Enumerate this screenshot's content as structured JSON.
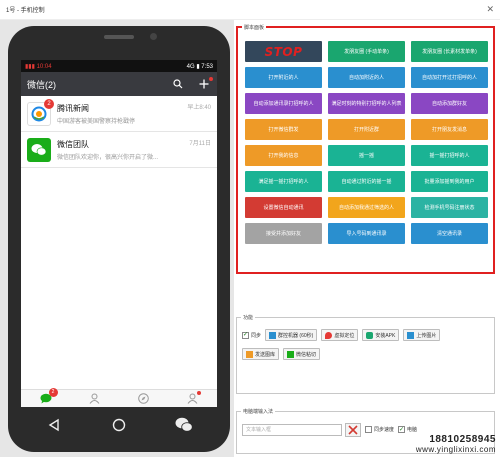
{
  "window": {
    "title": "1号 - 手机控制",
    "close": "✕"
  },
  "phone": {
    "status": {
      "left": "▮▮▮ 10:04",
      "right": "4G ▮ 7:53"
    },
    "header": {
      "title": "微信(2)"
    },
    "chats": [
      {
        "name": "腾讯新闻",
        "preview": "中国游客被美国警察持枪戳停",
        "time": "早上8:40",
        "badge": "2"
      },
      {
        "name": "微信团队",
        "preview": "微信团队欢迎你，很高兴你开启了微...",
        "time": "7月11日"
      }
    ],
    "tabbar": {
      "chats_badge": "2"
    }
  },
  "script_panel": {
    "legend": "脚本面板",
    "buttons": [
      {
        "label": "STOP",
        "color": "#33475b"
      },
      {
        "label": "发朋友圈 (手动单条)",
        "color": "#1aa66f"
      },
      {
        "label": "发朋友圈 (长素材发单条)",
        "color": "#1aa66f"
      },
      {
        "label": "打开附近的人",
        "color": "#2a8fcf"
      },
      {
        "label": "自动加附近的人",
        "color": "#2a8fcf"
      },
      {
        "label": "自动加打开过打招呼的人",
        "color": "#2a8fcf"
      },
      {
        "label": "自动添加通讯录打招呼的人",
        "color": "#8a47c3"
      },
      {
        "label": "满足时刻的特别打招呼的人列表",
        "color": "#8a47c3"
      },
      {
        "label": "自动添加群好友",
        "color": "#8a47c3"
      },
      {
        "label": "打开微信群发",
        "color": "#ee9a27"
      },
      {
        "label": "打开附近群",
        "color": "#ee9a27"
      },
      {
        "label": "打开朋友发消息",
        "color": "#ee9a27"
      },
      {
        "label": "打开我的信息",
        "color": "#ee9a27"
      },
      {
        "label": "摇一摇",
        "color": "#1ab394"
      },
      {
        "label": "摇一摇打招呼的人",
        "color": "#1ab394"
      },
      {
        "label": "满足摇一摇打招呼的人",
        "color": "#1ab394"
      },
      {
        "label": "自动通过附近的摇一摇",
        "color": "#1ab394"
      },
      {
        "label": "批量添加摇到我的用户",
        "color": "#1ab394"
      },
      {
        "label": "设置微信自动通讯",
        "color": "#d33b33"
      },
      {
        "label": "自动添加我通过筛选的人",
        "color": "#f2a51c"
      },
      {
        "label": "检测手机号码注册状态",
        "color": "#2bb3a3"
      },
      {
        "label": "接受并添加好友",
        "color": "#a3a3a3"
      },
      {
        "label": "导入号码到通讯录",
        "color": "#2a8fcf"
      },
      {
        "label": "清空通讯录",
        "color": "#2a8fcf"
      }
    ]
  },
  "function_panel": {
    "legend": "功能",
    "sync_label": "同步",
    "sync_checked": true,
    "buttons": [
      {
        "label": "群控机器 (60秒)",
        "icon_color": "#2a8fcf"
      },
      {
        "label": "虚拟定位",
        "icon_color": "#e53935"
      },
      {
        "label": "安装APK",
        "icon_color": "#1aa66f"
      },
      {
        "label": "上传图片",
        "icon_color": "#2a8fcf"
      }
    ],
    "row2": [
      {
        "label": "发送图库",
        "icon_color": "#ee9a27"
      },
      {
        "label": "微信粘切",
        "icon_color": "#1aad19"
      }
    ]
  },
  "input_panel": {
    "legend": "电脑端输入法",
    "placeholder": "文本输入框",
    "options": [
      {
        "label": "同步速度",
        "checked": false
      },
      {
        "label": "电脑",
        "checked": true
      }
    ]
  },
  "watermark": "18810258945",
  "watermark_url": "www.yinglixinxi.com"
}
